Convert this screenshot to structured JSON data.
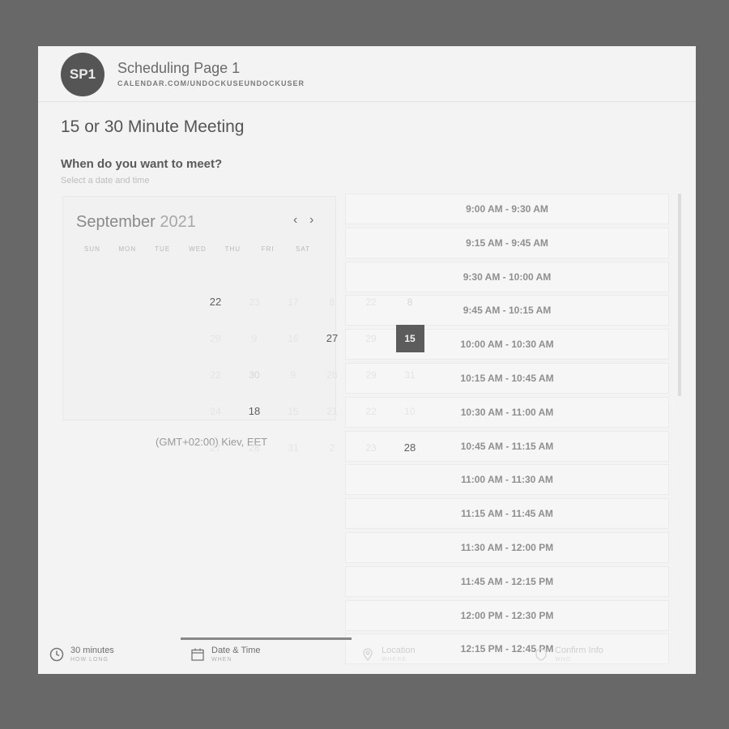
{
  "header": {
    "avatar_initials": "SP1",
    "page_name": "Scheduling Page 1",
    "page_url": "CALENDAR.COM/UNDOCKUSEUNDOCKUSER"
  },
  "meeting": {
    "title": "15 or 30 Minute Meeting",
    "prompt": "When do you want to meet?",
    "subprompt": "Select a date and time"
  },
  "calendar": {
    "month": "September",
    "year": "2021",
    "weekdays": [
      "SUN",
      "MON",
      "TUE",
      "WED",
      "THU",
      "FRI",
      "SAT"
    ],
    "days": [
      {
        "t": "22",
        "s": "active"
      },
      {
        "t": "23",
        "s": ""
      },
      {
        "t": "17",
        "s": ""
      },
      {
        "t": "8",
        "s": ""
      },
      {
        "t": "22",
        "s": ""
      },
      {
        "t": "8",
        "s": "faint2"
      },
      {
        "t": "29",
        "s": ""
      },
      {
        "t": "9",
        "s": ""
      },
      {
        "t": "16",
        "s": ""
      },
      {
        "t": "27",
        "s": "active"
      },
      {
        "t": "29",
        "s": ""
      },
      {
        "t": "15",
        "s": "selected"
      },
      {
        "t": "22",
        "s": ""
      },
      {
        "t": "30",
        "s": "faint2"
      },
      {
        "t": "9",
        "s": ""
      },
      {
        "t": "26",
        "s": ""
      },
      {
        "t": "29",
        "s": ""
      },
      {
        "t": "31",
        "s": ""
      },
      {
        "t": "24",
        "s": ""
      },
      {
        "t": "18",
        "s": "active"
      },
      {
        "t": "15",
        "s": ""
      },
      {
        "t": "21",
        "s": ""
      },
      {
        "t": "22",
        "s": ""
      },
      {
        "t": "10",
        "s": ""
      },
      {
        "t": "27",
        "s": ""
      },
      {
        "t": "28",
        "s": ""
      },
      {
        "t": "31",
        "s": ""
      },
      {
        "t": "2",
        "s": ""
      },
      {
        "t": "23",
        "s": ""
      },
      {
        "t": "28",
        "s": "active"
      }
    ]
  },
  "timezone": "(GMT+02:00) Kiev, EET",
  "slots": [
    "9:00 AM - 9:30 AM",
    "9:15 AM - 9:45 AM",
    "9:30 AM - 10:00 AM",
    "9:45 AM - 10:15 AM",
    "10:00 AM - 10:30 AM",
    "10:15 AM - 10:45 AM",
    "10:30 AM - 11:00 AM",
    "10:45 AM - 11:15 AM",
    "11:00 AM - 11:30 AM",
    "11:15 AM - 11:45 AM",
    "11:30 AM - 12:00 PM",
    "11:45 AM - 12:15 PM",
    "12:00 PM - 12:30 PM",
    "12:15 PM - 12:45 PM"
  ],
  "steps": [
    {
      "label": "30 minutes",
      "sub": "HOW LONG",
      "icon": "clock-icon"
    },
    {
      "label": "Date & Time",
      "sub": "WHEN",
      "icon": "calendar-icon"
    },
    {
      "label": "Location",
      "sub": "WHERE",
      "icon": "location-pin-icon"
    },
    {
      "label": "Confirm Info",
      "sub": "WHO",
      "icon": "shield-icon"
    }
  ]
}
